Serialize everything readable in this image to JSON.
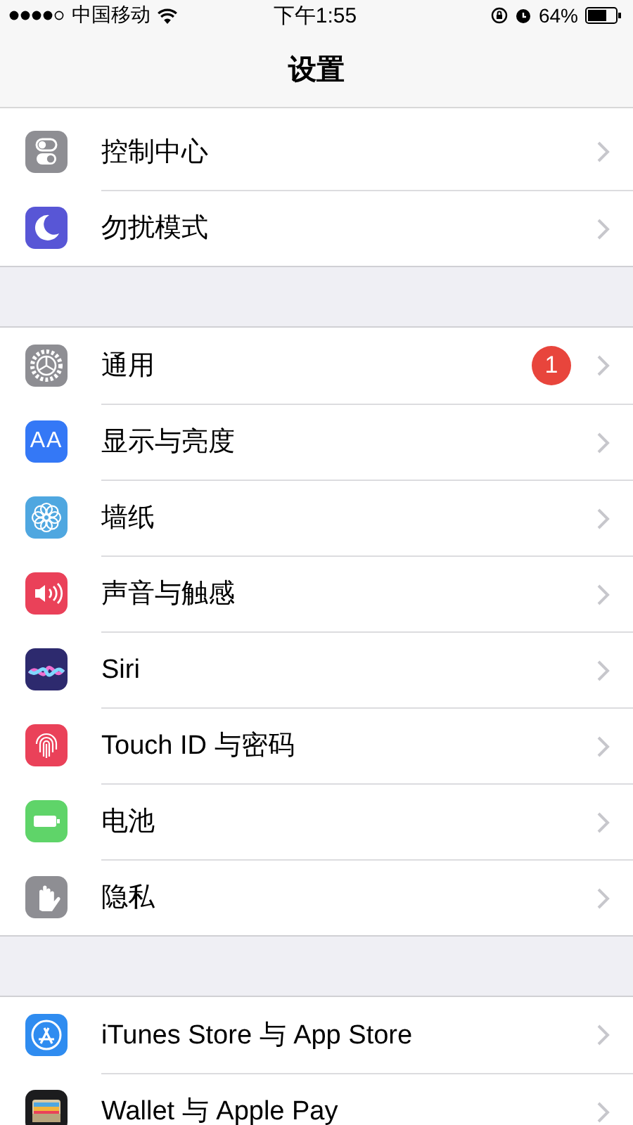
{
  "status_bar": {
    "carrier": "中国移动",
    "time": "下午1:55",
    "battery": "64%"
  },
  "nav_bar": {
    "title": "设置"
  },
  "groups": [
    {
      "items": [
        {
          "label": "控制中心",
          "color": "#8e8e93"
        },
        {
          "label": "勿扰模式",
          "color": "#5856d6"
        }
      ]
    },
    {
      "items": [
        {
          "label": "通用",
          "color": "#8e8e93",
          "badge": "1"
        },
        {
          "label": "显示与亮度",
          "color": "#3478f6",
          "icon_text": "AA"
        },
        {
          "label": "墙纸",
          "color": "#4fa7e0"
        },
        {
          "label": "声音与触感",
          "color": "#ea4159"
        },
        {
          "label": "Siri",
          "color": "#2d2a6e"
        },
        {
          "label": "Touch ID 与密码",
          "color": "#ea4159"
        },
        {
          "label": "电池",
          "color": "#5fd469"
        },
        {
          "label": "隐私",
          "color": "#8e8e93"
        }
      ]
    },
    {
      "items": [
        {
          "label": "iTunes Store 与 App Store",
          "color": "#2f8cf0"
        },
        {
          "label": "Wallet 与 Apple Pay",
          "color": "#1c1c1e"
        }
      ]
    }
  ]
}
